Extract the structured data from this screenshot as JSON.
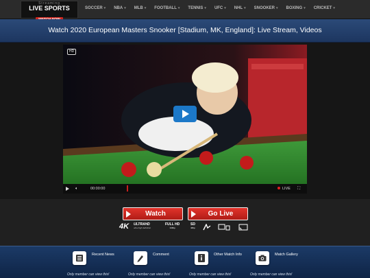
{
  "logo": {
    "top_text": "Streaming",
    "main_text": "LIVE SPORTS",
    "button_label": "WATCH NOW"
  },
  "nav": {
    "items": [
      {
        "label": "SOCCER"
      },
      {
        "label": "NBA"
      },
      {
        "label": "MLB"
      },
      {
        "label": "FOOTBALL"
      },
      {
        "label": "TENNIS"
      },
      {
        "label": "UFC"
      },
      {
        "label": "NHL"
      },
      {
        "label": "SNOOKER"
      },
      {
        "label": "BOXING"
      },
      {
        "label": "CRICKET"
      }
    ]
  },
  "page_title": "Watch 2020 European Masters Snooker [Stadium, MK, England]: Live Stream, Videos",
  "player": {
    "hd_label": "HD",
    "time": "00:00:00",
    "live_label": "LIVE"
  },
  "buttons": {
    "watch": "Watch",
    "go_live": "Go Live"
  },
  "formats": {
    "k4": "4K",
    "uhd": "ULTRAHD",
    "uhd_sub": "ultra high definition",
    "fhd": "FULL HD",
    "fhd_sub": "1080p",
    "sd": "SD",
    "sd_sub": "480p"
  },
  "features": [
    {
      "label": "Recent News",
      "note": "Only member can view this!",
      "icon": "news-icon"
    },
    {
      "label": "Comment",
      "note": "Only member can view this!",
      "icon": "comment-icon"
    },
    {
      "label": "Other Match Info",
      "note": "Only member can view this!",
      "icon": "info-icon"
    },
    {
      "label": "Match Gallery",
      "note": "Only member can view this!",
      "icon": "camera-icon"
    }
  ],
  "colors": {
    "accent_red": "#d0261f",
    "header_blue": "#1d3660",
    "play_blue": "#1c78c8"
  }
}
